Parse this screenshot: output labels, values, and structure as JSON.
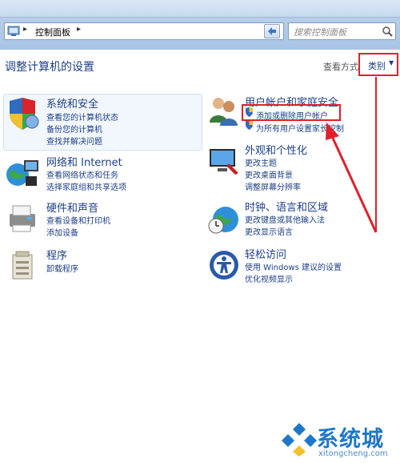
{
  "address": {
    "breadcrumb": "控制面板"
  },
  "search": {
    "placeholder": "搜索控制面板"
  },
  "header": {
    "title": "调整计算机的设置",
    "view_by_label": "查看方式",
    "view_by_value": "类别"
  },
  "categories": [
    {
      "title": "系统和安全",
      "links": [
        "查看您的计算机状态",
        "备份您的计算机",
        "查找并解决问题"
      ],
      "icon": "shield-icon"
    },
    {
      "title": "网络和 Internet",
      "links": [
        "查看网络状态和任务",
        "选择家庭组和共享选项"
      ],
      "icon": "globe-network-icon"
    },
    {
      "title": "硬件和声音",
      "links": [
        "查看设备和打印机",
        "添加设备"
      ],
      "icon": "printer-icon"
    },
    {
      "title": "程序",
      "links": [
        "卸载程序"
      ],
      "icon": "programs-icon"
    },
    {
      "title": "用户帐户和家庭安全",
      "links": [
        "添加或删除用户帐户",
        "为所有用户设置家长控制"
      ],
      "icon": "users-icon"
    },
    {
      "title": "外观和个性化",
      "links": [
        "更改主题",
        "更改桌面背景",
        "调整屏幕分辨率"
      ],
      "icon": "display-icon"
    },
    {
      "title": "时钟、语言和区域",
      "links": [
        "更改键盘或其他输入法",
        "更改显示语言"
      ],
      "icon": "clock-globe-icon"
    },
    {
      "title": "轻松访问",
      "links": [
        "使用 Windows 建议的设置",
        "优化视频显示"
      ],
      "icon": "accessibility-icon"
    }
  ],
  "watermark": {
    "title": "系统城",
    "subtitle": "xitongcheng.com"
  },
  "colors": {
    "link": "#1e3f8a",
    "highlight": "#e0202a",
    "chrome": "#b5cde9"
  }
}
